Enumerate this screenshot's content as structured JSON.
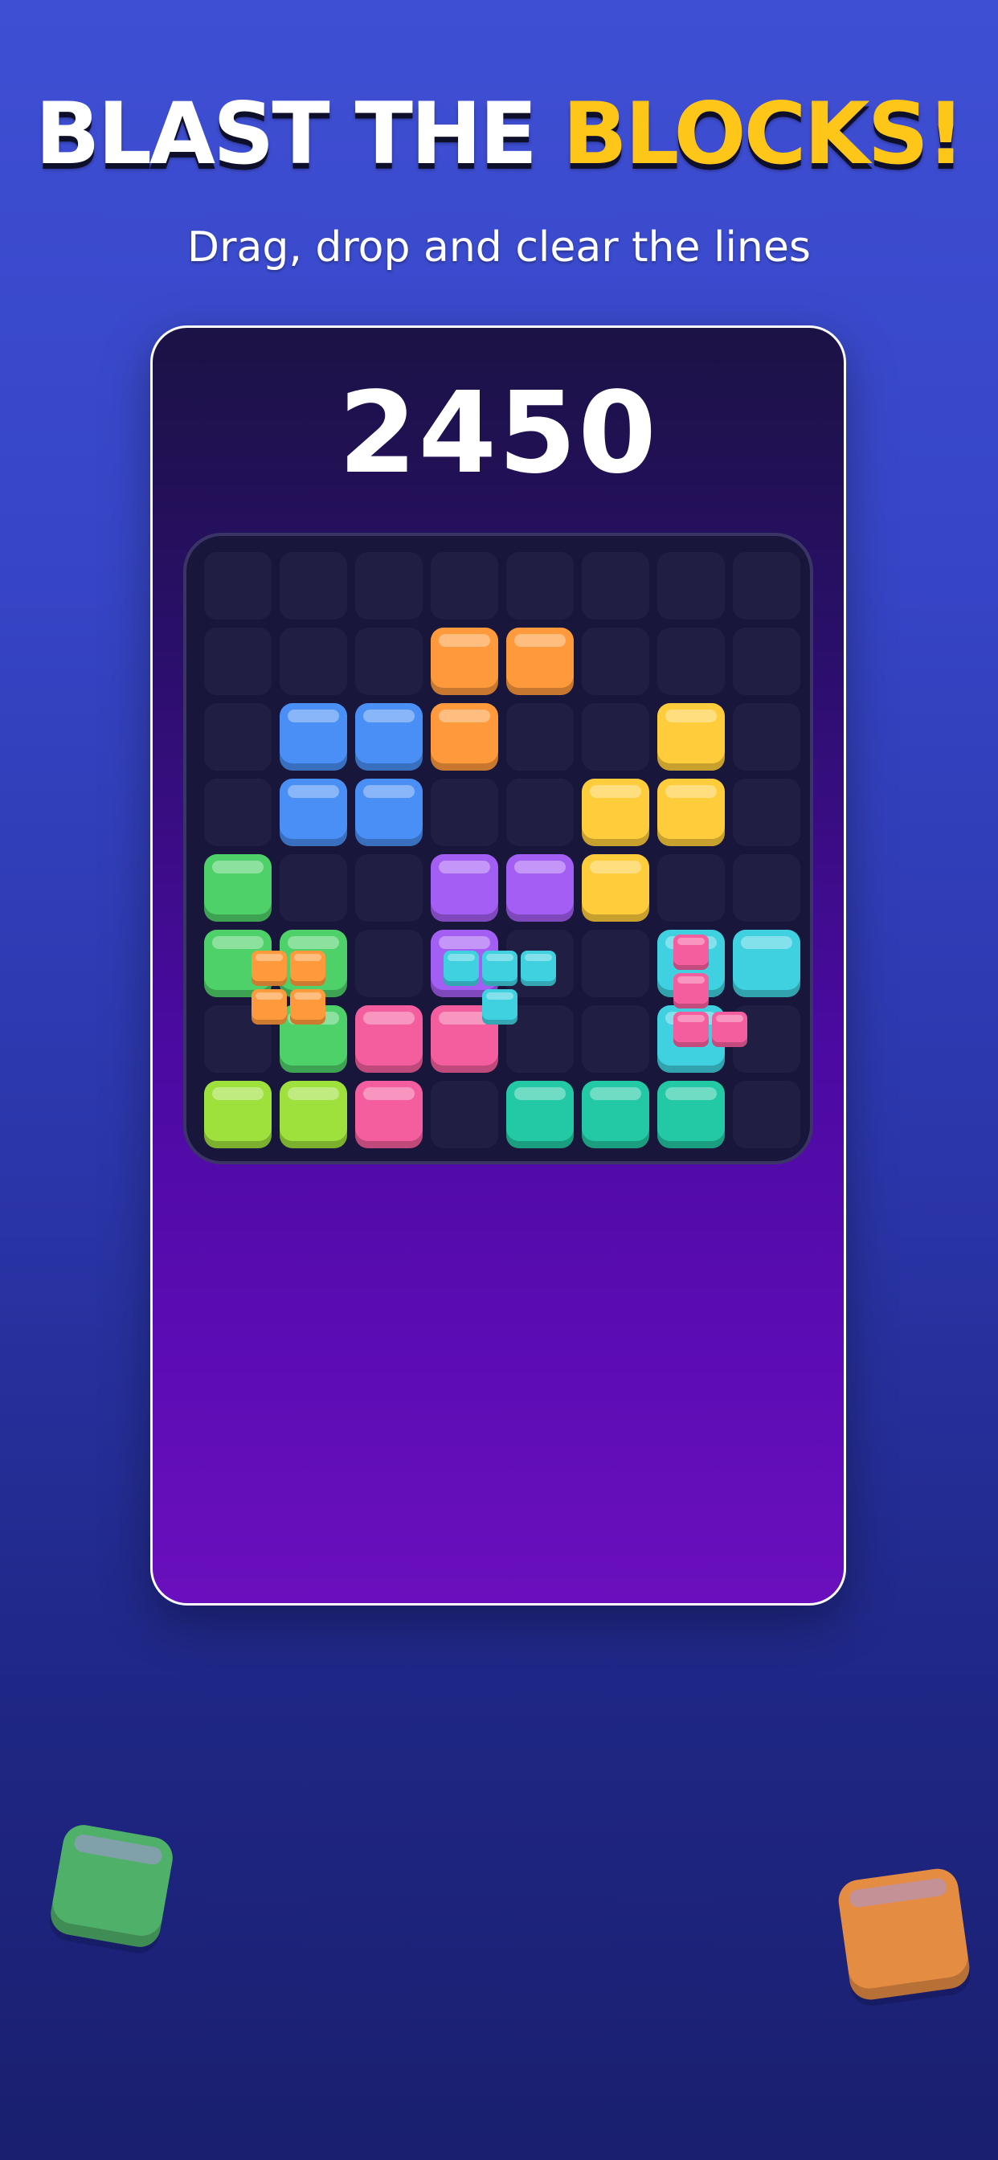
{
  "header": {
    "title_part1": "BLAST THE ",
    "title_part2": "BLOCKS!",
    "subtitle": "Drag, drop and clear the lines"
  },
  "colors": {
    "orange": "#ff9a3c",
    "blue": "#4a8ff5",
    "yellow": "#ffcd3c",
    "green": "#4fd16a",
    "purple": "#a35ef3",
    "cyan": "#3fd1e0",
    "pink": "#f55e9e",
    "lime": "#9ee03c",
    "teal": "#23c9a4",
    "title_accent": "#ffc61a"
  },
  "game": {
    "score": "2450",
    "board_rows": [
      [
        "",
        "",
        "",
        "",
        "",
        "",
        "",
        ""
      ],
      [
        "",
        "",
        "",
        "orange",
        "orange",
        "",
        "",
        ""
      ],
      [
        "",
        "blue",
        "blue",
        "orange",
        "",
        "",
        "yellow",
        ""
      ],
      [
        "",
        "blue",
        "blue",
        "",
        "",
        "yellow",
        "yellow",
        ""
      ],
      [
        "green",
        "",
        "",
        "purple",
        "purple",
        "yellow",
        "",
        ""
      ],
      [
        "green",
        "green",
        "",
        "purple",
        "",
        "",
        "cyan",
        "cyan"
      ],
      [
        "",
        "green",
        "pink",
        "pink",
        "",
        "",
        "cyan",
        ""
      ],
      [
        "lime",
        "lime",
        "pink",
        "",
        "teal",
        "teal",
        "teal",
        ""
      ]
    ],
    "tray_pieces": [
      {
        "name": "square-piece",
        "color": "orange",
        "shape": [
          [
            1,
            1
          ],
          [
            1,
            1
          ]
        ]
      },
      {
        "name": "t-piece",
        "color": "cyan",
        "shape": [
          [
            1,
            1,
            1
          ],
          [
            0,
            1,
            0
          ]
        ]
      },
      {
        "name": "l-piece",
        "color": "pink",
        "shape": [
          [
            1,
            0
          ],
          [
            1,
            0
          ],
          [
            1,
            1
          ]
        ]
      }
    ]
  },
  "decorations": [
    {
      "name": "floating-green-block",
      "color": "green"
    },
    {
      "name": "floating-orange-block",
      "color": "orange"
    }
  ]
}
